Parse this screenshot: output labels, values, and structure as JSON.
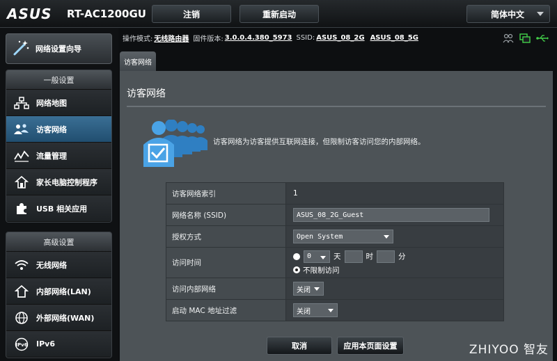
{
  "header": {
    "brand": "ASUS",
    "model": "RT-AC1200GU",
    "logout_label": "注销",
    "reboot_label": "重新启动",
    "language": "简体中文"
  },
  "info": {
    "mode_label": "操作模式:",
    "mode_value": "无线路由器",
    "firmware_label": "固件版本:",
    "firmware_value": "3.0.0.4.380_5973",
    "ssid_label": "SSID:",
    "ssid_2g": "ASUS_08_2G",
    "ssid_5g": "ASUS_08_5G"
  },
  "sidebar": {
    "wizard_label": "网络设置向导",
    "general_head": "一般设置",
    "general_items": [
      {
        "label": "网络地图",
        "icon": "network-map-icon"
      },
      {
        "label": "访客网络",
        "icon": "guest-network-icon",
        "active": true
      },
      {
        "label": "流量管理",
        "icon": "traffic-icon"
      },
      {
        "label": "家长电脑控制程序",
        "icon": "parental-control-icon"
      },
      {
        "label": "USB 相关应用",
        "icon": "usb-app-icon"
      }
    ],
    "advanced_head": "高级设置",
    "advanced_items": [
      {
        "label": "无线网络",
        "icon": "wireless-icon"
      },
      {
        "label": "内部网络(LAN)",
        "icon": "lan-icon"
      },
      {
        "label": "外部网络(WAN)",
        "icon": "wan-icon"
      },
      {
        "label": "IPv6",
        "icon": "ipv6-icon"
      }
    ]
  },
  "tab_label": "访客网络",
  "panel": {
    "title": "访客网络",
    "description": "访客网络为访客提供互联网连接，但限制访客访问您的内部网络。",
    "rows": {
      "index_label": "访客网络索引",
      "index_value": "1",
      "ssid_label": "网络名称 (SSID)",
      "ssid_value": "ASUS_08_2G_Guest",
      "auth_label": "授权方式",
      "auth_value": "Open System",
      "time_label": "访问时间",
      "time_days_value": "0",
      "time_day_unit": "天",
      "time_hour_unit": "时",
      "time_min_unit": "分",
      "time_unlimited": "不限制访问",
      "intranet_label": "访问内部网络",
      "intranet_value": "关闭",
      "mac_label": "启动 MAC 地址过滤",
      "mac_value": "关闭"
    },
    "cancel_label": "取消",
    "apply_label": "应用本页面设置"
  },
  "watermark": "ZHIYOO 智友"
}
